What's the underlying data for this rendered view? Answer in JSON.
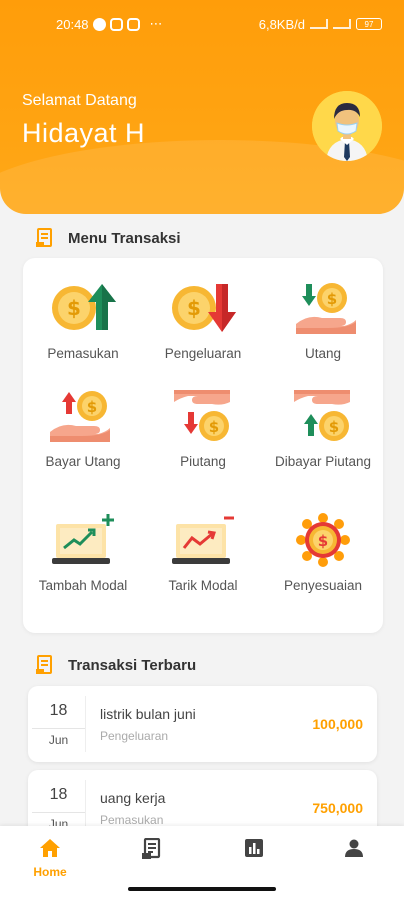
{
  "status_bar": {
    "time": "20:48",
    "dots": "⋯",
    "network_speed": "6,8KB/d",
    "battery": "97"
  },
  "header": {
    "greeting": "Selamat Datang",
    "username": "Hidayat H"
  },
  "menu_section": {
    "title": "Menu Transaksi",
    "items": [
      {
        "label": "Pemasukan",
        "icon": "coin-arrow-up-icon"
      },
      {
        "label": "Pengeluaran",
        "icon": "coin-arrow-down-icon"
      },
      {
        "label": "Utang",
        "icon": "hand-coin-arrow-down-icon"
      },
      {
        "label": "Bayar Utang",
        "icon": "hand-coin-arrow-up-icon"
      },
      {
        "label": "Piutang",
        "icon": "hand-coin-receive-icon"
      },
      {
        "label": "Dibayar Piutang",
        "icon": "hand-coin-return-icon"
      },
      {
        "label": "Tambah Modal",
        "icon": "laptop-chart-up-icon"
      },
      {
        "label": "Tarik Modal",
        "icon": "laptop-chart-down-icon"
      },
      {
        "label": "Penyesuaian",
        "icon": "coin-gear-icon"
      }
    ]
  },
  "recent_section": {
    "title": "Transaksi Terbaru",
    "transactions": [
      {
        "day": "18",
        "month": "Jun",
        "name": "listrik bulan juni",
        "category": "Pengeluaran",
        "amount": "100,000"
      },
      {
        "day": "18",
        "month": "Jun",
        "name": "uang kerja",
        "category": "Pemasukan",
        "amount": "750,000"
      }
    ]
  },
  "bottom_nav": {
    "items": [
      {
        "label": "Home",
        "icon": "home-icon",
        "active": true
      },
      {
        "label": "",
        "icon": "document-icon",
        "active": false
      },
      {
        "label": "",
        "icon": "bar-chart-icon",
        "active": false
      },
      {
        "label": "",
        "icon": "person-icon",
        "active": false
      }
    ]
  },
  "colors": {
    "primary": "#ffa000",
    "header_bg": "#ff9d0a",
    "coin": "#f7b733",
    "arrow_green": "#1e8e5a",
    "arrow_red": "#e53935",
    "hand": "#f6a68c"
  }
}
